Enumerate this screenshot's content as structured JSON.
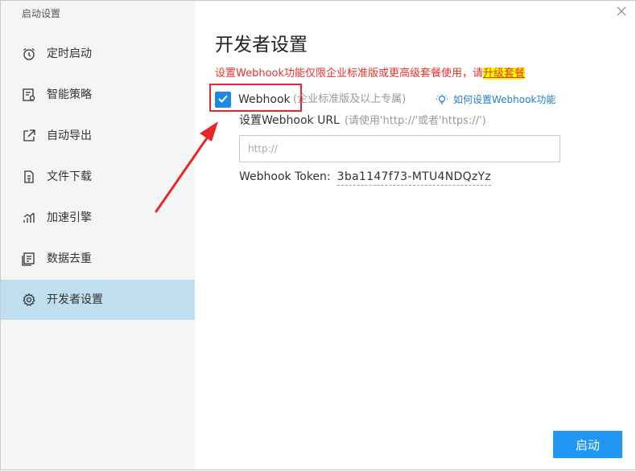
{
  "window": {
    "title": "启动设置"
  },
  "sidebar": {
    "items": [
      {
        "label": "定时启动",
        "icon": "alarm-clock-icon"
      },
      {
        "label": "智能策略",
        "icon": "strategy-icon"
      },
      {
        "label": "自动导出",
        "icon": "export-icon"
      },
      {
        "label": "文件下载",
        "icon": "file-download-icon"
      },
      {
        "label": "加速引擎",
        "icon": "speed-chart-icon"
      },
      {
        "label": "数据去重",
        "icon": "dedupe-icon"
      },
      {
        "label": "开发者设置",
        "icon": "gear-icon",
        "active": true
      }
    ]
  },
  "main": {
    "title": "开发者设置",
    "warning": "设置Webhook功能仅限企业标准版或更高级套餐使用，请",
    "upgrade_link": "升级套餐",
    "webhook_checkbox": {
      "label": "Webhook",
      "checked": true,
      "hint": "(企业标准版及以上专属)"
    },
    "help_link": "如何设置Webhook功能",
    "url_field": {
      "label": "设置Webhook URL",
      "hint": "(请使用'http://'或者'https://')",
      "placeholder": "http://",
      "value": ""
    },
    "token": {
      "label": "Webhook Token:",
      "value": "3ba1147f73-MTU4NDQzYz"
    },
    "start_button": "启动"
  },
  "colors": {
    "accent": "#2196f3",
    "active_nav": "#bfdff1",
    "warning": "#e5322d",
    "annotation": "#e8262a"
  }
}
